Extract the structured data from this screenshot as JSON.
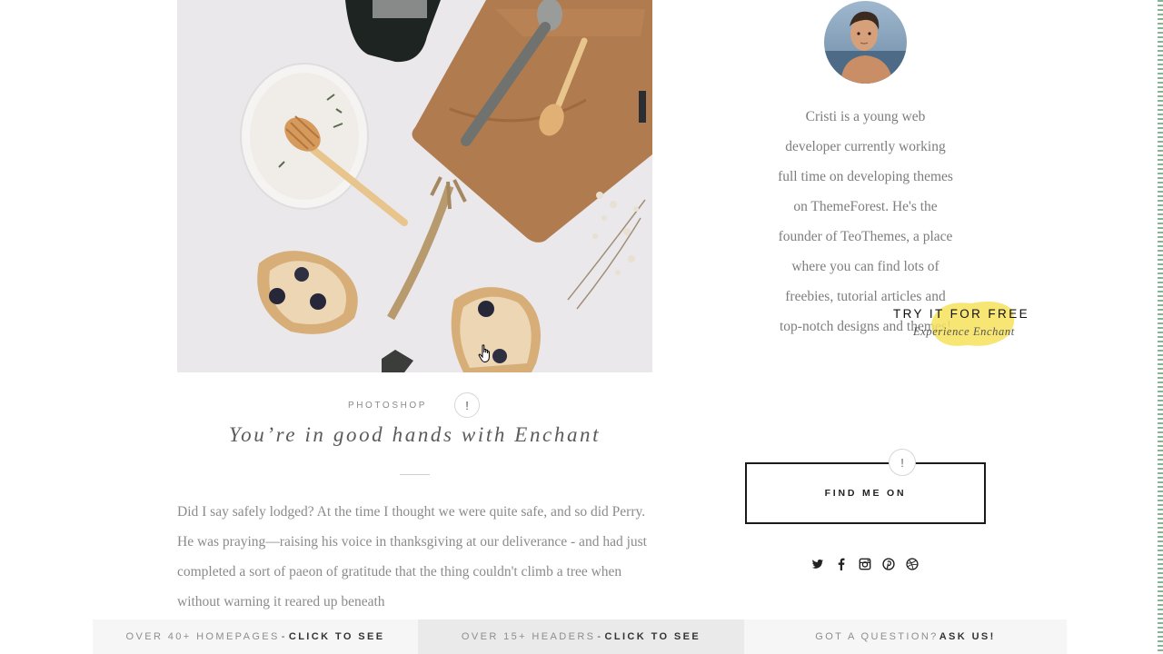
{
  "post": {
    "category": "PHOTOSHOP",
    "category_badge": "!",
    "title": "You’re in good hands with Enchant",
    "excerpt": "Did I say safely lodged? At the time I thought we were quite safe, and so did Perry. He was praying—raising his voice in thanksgiving at our deliverance - and had just completed a sort of paeon of gratitude that the thing couldn't climb a tree when without warning it reared up beneath"
  },
  "sidebar": {
    "bio": "Cristi is a young web developer currently working full time on developing themes on ThemeForest. He's the founder of TeoThemes, a place where you can find lots of freebies, tutorial articles and top-notch designs and themes!",
    "find_me_label": "FIND ME ON",
    "find_me_badge": "!",
    "socials": [
      "twitter-icon",
      "facebook-icon",
      "instagram-icon",
      "pinterest-icon",
      "dribbble-icon"
    ]
  },
  "promo": {
    "title": "TRY IT FOR FREE",
    "subtitle": "Experience Enchant",
    "accent_color": "#f7e25c"
  },
  "bottom_bar": [
    {
      "light": "OVER 40+ HOMEPAGES",
      "dash": "-",
      "bold": "CLICK TO SEE"
    },
    {
      "light": "OVER 15+ HEADERS",
      "dash": "-",
      "bold": "CLICK TO SEE"
    },
    {
      "light": "GOT A QUESTION?",
      "dash": "",
      "bold": "ASK US!"
    }
  ]
}
